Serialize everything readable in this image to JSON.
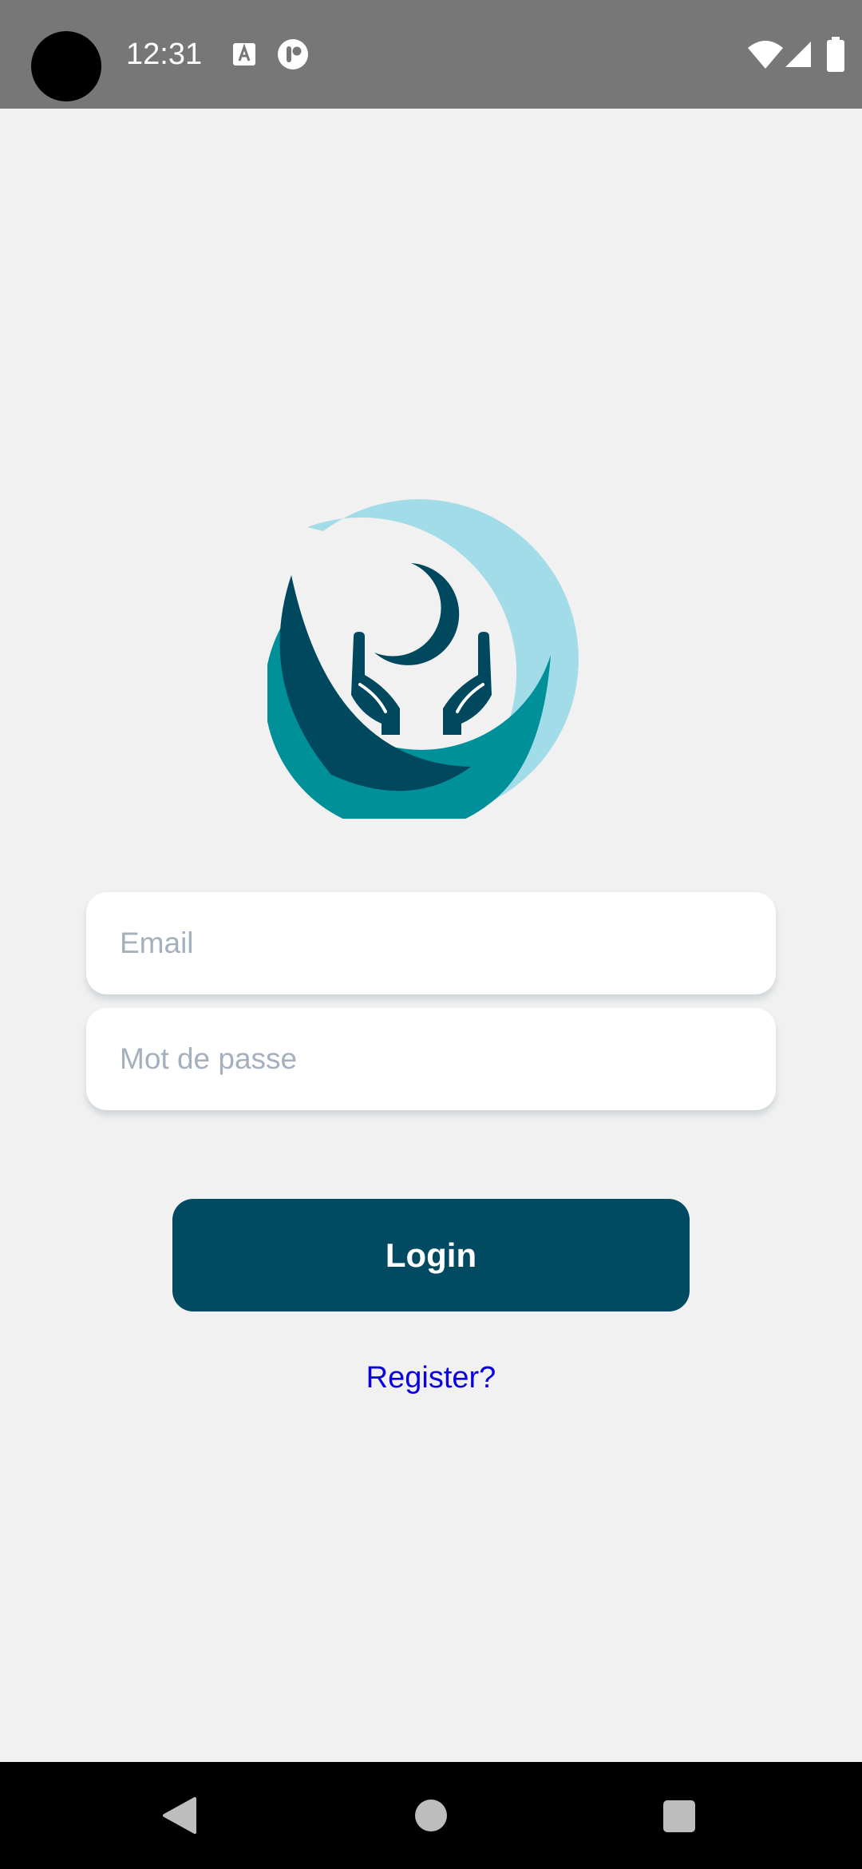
{
  "status_bar": {
    "time": "12:31",
    "notification_icons": [
      "keyboard-a-icon",
      "app-notification-icon"
    ],
    "system_icons": [
      "wifi-icon",
      "cellular-signal-icon",
      "battery-icon"
    ]
  },
  "logo": {
    "icon": "hands-holding-moon-logo"
  },
  "login_form": {
    "email_placeholder": "Email",
    "email_value": "",
    "password_placeholder": "Mot de passe",
    "password_value": "",
    "login_label": "Login",
    "register_link": "Register?"
  },
  "navigation_bar": {
    "buttons": [
      "back-icon",
      "home-icon",
      "recents-icon"
    ]
  },
  "colors": {
    "background": "#f1f1f1",
    "status_bar": "#777777",
    "primary": "#004b62",
    "teal": "#00909a",
    "light_blue": "#a2dce8",
    "link": "#0a00e0",
    "placeholder": "#a4b0bd"
  }
}
